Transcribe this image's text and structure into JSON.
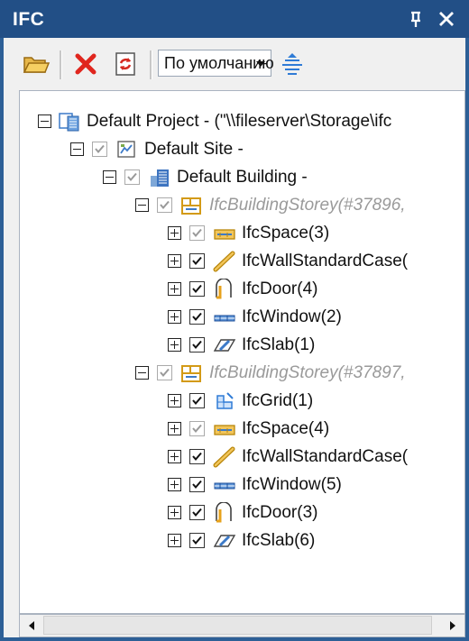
{
  "window": {
    "title": "IFC",
    "pin_icon": "pin-icon",
    "close_icon": "close-icon"
  },
  "toolbar": {
    "open_icon": "folder-open-icon",
    "delete_icon": "delete-x-icon",
    "refresh_icon": "refresh-icon",
    "view_mode": "По умолчанию",
    "options_icon": "layers-options-icon"
  },
  "tree": {
    "project": "Default Project -  (\"\\\\fileserver\\Storage\\ifc",
    "site": "Default Site -",
    "building": "Default Building -",
    "storey1": "IfcBuildingStorey(#37896,",
    "storey1_items": [
      "IfcSpace(3)",
      "IfcWallStandardCase(",
      "IfcDoor(4)",
      "IfcWindow(2)",
      "IfcSlab(1)"
    ],
    "storey2": "IfcBuildingStorey(#37897,",
    "storey2_items": [
      "IfcGrid(1)",
      "IfcSpace(4)",
      "IfcWallStandardCase(",
      "IfcWindow(5)",
      "IfcDoor(3)",
      "IfcSlab(6)"
    ]
  },
  "colors": {
    "titlebar": "#224f86",
    "accent_red": "#e0261e",
    "icon_blue": "#2f7bd6",
    "icon_orange": "#e7a21c"
  }
}
